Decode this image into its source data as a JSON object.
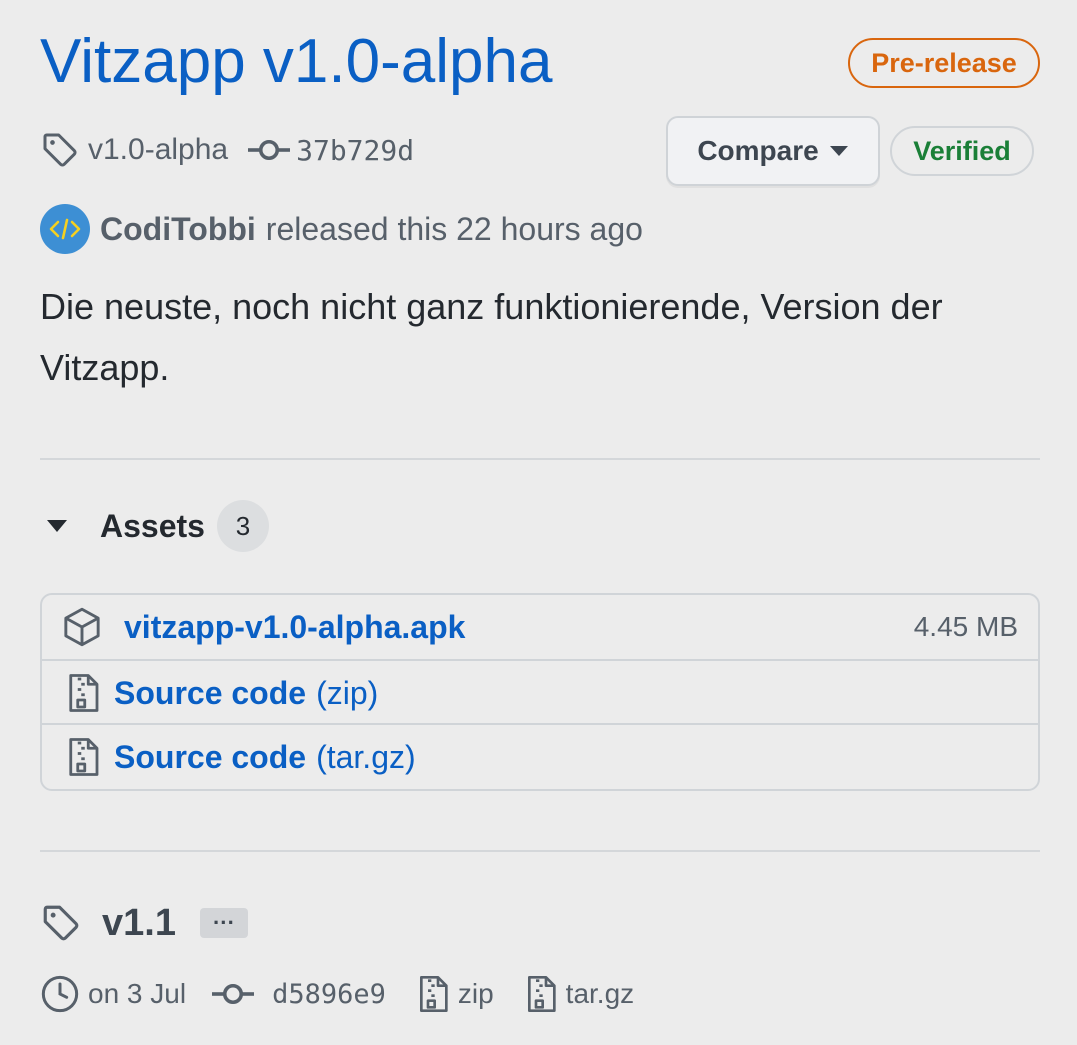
{
  "release": {
    "title": "Vitzapp v1.0-alpha",
    "badge": "Pre-release",
    "tag": "v1.0-alpha",
    "commit": "37b729d",
    "compare_label": "Compare",
    "verified_label": "Verified",
    "author": "CodiTobbi",
    "released_text": "released this 22 hours ago",
    "description": "Die neuste, noch nicht ganz funktionierende, Version der Vitzapp."
  },
  "assets": {
    "label": "Assets",
    "count": "3",
    "items": [
      {
        "name": "vitzapp-v1.0-alpha.apk",
        "suffix": "",
        "size": "4.45 MB",
        "icon": "package-icon"
      },
      {
        "name": "Source code",
        "suffix": "(zip)",
        "size": "",
        "icon": "file-zip-icon"
      },
      {
        "name": "Source code",
        "suffix": "(tar.gz)",
        "size": "",
        "icon": "file-zip-icon"
      }
    ]
  },
  "next_release": {
    "tag": "v1.1",
    "ellipsis": "···",
    "date": "on 3 Jul",
    "commit": "d5896e9",
    "zip_label": "zip",
    "targz_label": "tar.gz"
  },
  "colors": {
    "link": "#0a5fc4",
    "prerelease": "#d9660e",
    "verified": "#1a7f37",
    "background": "#ececec"
  }
}
